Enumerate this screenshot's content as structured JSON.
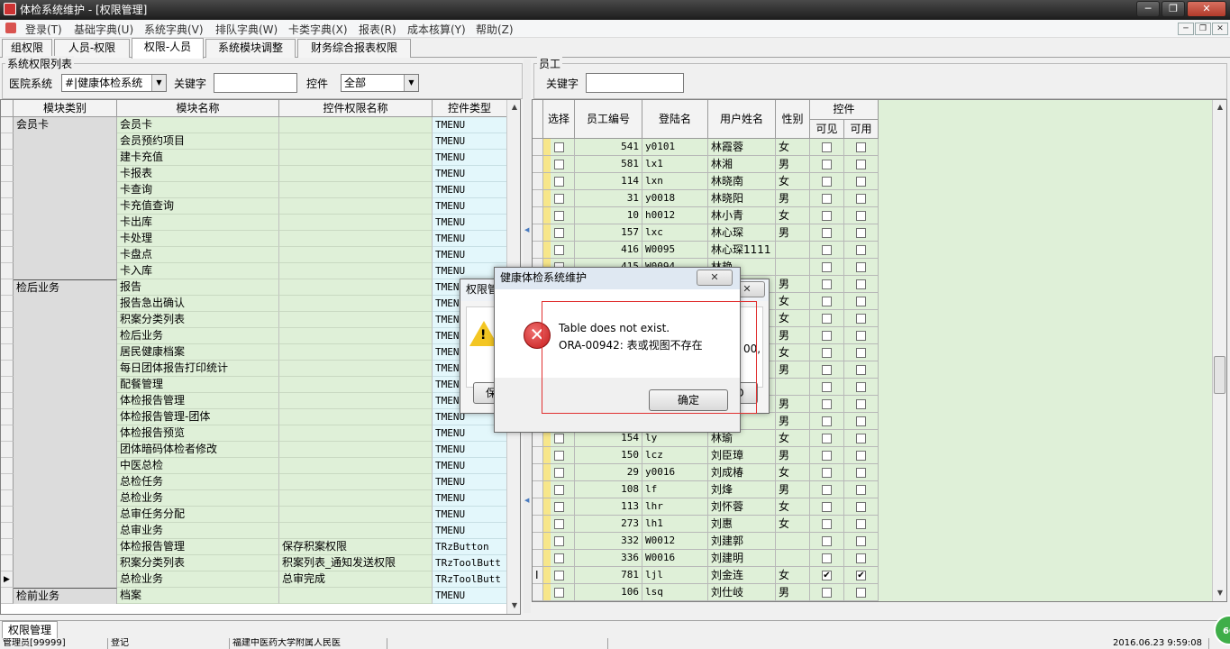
{
  "window": {
    "title": "体检系统维护 - [权限管理]"
  },
  "menu": [
    "登录(T)",
    "基础字典(U)",
    "系统字典(V)",
    "排队字典(W)",
    "卡类字典(X)",
    "报表(R)",
    "成本核算(Y)",
    "帮助(Z)"
  ],
  "tabs": [
    "组权限",
    "人员-权限",
    "权限-人员",
    "系统模块调整",
    "财务综合报表权限"
  ],
  "left": {
    "title": "系统权限列表",
    "hospital_label": "医院系统",
    "hospital_value": "#|健康体检系统",
    "keyword_label": "关键字",
    "keyword_value": "",
    "control_label": "控件",
    "control_value": "全部",
    "columns": [
      "模块类别",
      "模块名称",
      "控件权限名称",
      "控件类型"
    ],
    "rows": [
      {
        "cat": "会员卡",
        "name": "会员卡",
        "perm": "",
        "type": "TMENU"
      },
      {
        "cat": "",
        "name": "会员预约项目",
        "perm": "",
        "type": "TMENU"
      },
      {
        "cat": "",
        "name": "建卡充值",
        "perm": "",
        "type": "TMENU"
      },
      {
        "cat": "",
        "name": "卡报表",
        "perm": "",
        "type": "TMENU"
      },
      {
        "cat": "",
        "name": "卡查询",
        "perm": "",
        "type": "TMENU"
      },
      {
        "cat": "",
        "name": "卡充值查询",
        "perm": "",
        "type": "TMENU"
      },
      {
        "cat": "",
        "name": "卡出库",
        "perm": "",
        "type": "TMENU"
      },
      {
        "cat": "",
        "name": "卡处理",
        "perm": "",
        "type": "TMENU"
      },
      {
        "cat": "",
        "name": "卡盘点",
        "perm": "",
        "type": "TMENU"
      },
      {
        "cat": "",
        "name": "卡入库",
        "perm": "",
        "type": "TMENU"
      },
      {
        "cat": "检后业务",
        "name": "报告",
        "perm": "",
        "type": "TMENU"
      },
      {
        "cat": "",
        "name": "报告急出确认",
        "perm": "",
        "type": "TMENU"
      },
      {
        "cat": "",
        "name": "积案分类列表",
        "perm": "",
        "type": "TMENU"
      },
      {
        "cat": "",
        "name": "检后业务",
        "perm": "",
        "type": "TMENU"
      },
      {
        "cat": "",
        "name": "居民健康档案",
        "perm": "",
        "type": "TMENU"
      },
      {
        "cat": "",
        "name": "每日团体报告打印统计",
        "perm": "",
        "type": "TMENU"
      },
      {
        "cat": "",
        "name": "配餐管理",
        "perm": "",
        "type": "TMENU"
      },
      {
        "cat": "",
        "name": "体检报告管理",
        "perm": "",
        "type": "TMENU"
      },
      {
        "cat": "",
        "name": "体检报告管理-团体",
        "perm": "",
        "type": "TMENU"
      },
      {
        "cat": "",
        "name": "体检报告预览",
        "perm": "",
        "type": "TMENU"
      },
      {
        "cat": "",
        "name": "团体暗码体检者修改",
        "perm": "",
        "type": "TMENU"
      },
      {
        "cat": "",
        "name": "中医总检",
        "perm": "",
        "type": "TMENU"
      },
      {
        "cat": "",
        "name": "总检任务",
        "perm": "",
        "type": "TMENU"
      },
      {
        "cat": "",
        "name": "总检业务",
        "perm": "",
        "type": "TMENU"
      },
      {
        "cat": "",
        "name": "总审任务分配",
        "perm": "",
        "type": "TMENU"
      },
      {
        "cat": "",
        "name": "总审业务",
        "perm": "",
        "type": "TMENU"
      },
      {
        "cat": "",
        "name": "体检报告管理",
        "perm": "保存积案权限",
        "type": "TRzButton"
      },
      {
        "cat": "",
        "name": "积案分类列表",
        "perm": "积案列表_通知发送权限",
        "type": "TRzToolButt"
      },
      {
        "cat": "",
        "name": "总检业务",
        "perm": "总审完成",
        "type": "TRzToolButt"
      },
      {
        "cat": "检前业务",
        "name": "档案",
        "perm": "",
        "type": "TMENU"
      }
    ]
  },
  "right": {
    "title": "员工",
    "keyword_label": "关键字",
    "keyword_value": "",
    "columns": {
      "select": "选择",
      "id": "员工编号",
      "login": "登陆名",
      "name": "用户姓名",
      "sex": "性别",
      "control": "控件",
      "visible": "可见",
      "enabled": "可用"
    },
    "rows": [
      {
        "id": "541",
        "login": "y0101",
        "name": "林霞蓉",
        "sex": "女",
        "vis": false,
        "en": false
      },
      {
        "id": "581",
        "login": "lx1",
        "name": "林湘",
        "sex": "男",
        "vis": false,
        "en": false
      },
      {
        "id": "114",
        "login": "lxn",
        "name": "林晓南",
        "sex": "女",
        "vis": false,
        "en": false
      },
      {
        "id": "31",
        "login": "y0018",
        "name": "林晓阳",
        "sex": "男",
        "vis": false,
        "en": false
      },
      {
        "id": "10",
        "login": "h0012",
        "name": "林小青",
        "sex": "女",
        "vis": false,
        "en": false
      },
      {
        "id": "157",
        "login": "lxc",
        "name": "林心琛",
        "sex": "男",
        "vis": false,
        "en": false
      },
      {
        "id": "416",
        "login": "W0095",
        "name": "林心琛1111",
        "sex": "",
        "vis": false,
        "en": false
      },
      {
        "id": "415",
        "login": "W0094",
        "name": "林艳",
        "sex": "",
        "vis": false,
        "en": false
      },
      {
        "id": "",
        "login": "",
        "name": "",
        "sex": "男",
        "vis": false,
        "en": false
      },
      {
        "id": "",
        "login": "",
        "name": "",
        "sex": "女",
        "vis": false,
        "en": false
      },
      {
        "id": "",
        "login": "",
        "name": "",
        "sex": "女",
        "vis": false,
        "en": false
      },
      {
        "id": "",
        "login": "",
        "name": "",
        "sex": "男",
        "vis": false,
        "en": false
      },
      {
        "id": "",
        "login": "",
        "name": "",
        "sex": "女",
        "vis": false,
        "en": false
      },
      {
        "id": "",
        "login": "",
        "name": "",
        "sex": "男",
        "vis": false,
        "en": false
      },
      {
        "id": "",
        "login": "",
        "name": "",
        "sex": "",
        "vis": false,
        "en": false
      },
      {
        "id": "",
        "login": "",
        "name": "",
        "sex": "男",
        "vis": false,
        "en": false
      },
      {
        "id": "",
        "login": "",
        "name": "",
        "sex": "男",
        "vis": false,
        "en": false
      },
      {
        "id": "154",
        "login": "ly",
        "name": "林瑜",
        "sex": "女",
        "vis": false,
        "en": false
      },
      {
        "id": "150",
        "login": "lcz",
        "name": "刘臣璋",
        "sex": "男",
        "vis": false,
        "en": false
      },
      {
        "id": "29",
        "login": "y0016",
        "name": "刘成椿",
        "sex": "女",
        "vis": false,
        "en": false
      },
      {
        "id": "108",
        "login": "lf",
        "name": "刘烽",
        "sex": "男",
        "vis": false,
        "en": false
      },
      {
        "id": "113",
        "login": "lhr",
        "name": "刘怀蓉",
        "sex": "女",
        "vis": false,
        "en": false
      },
      {
        "id": "273",
        "login": "lh1",
        "name": "刘惠",
        "sex": "女",
        "vis": false,
        "en": false
      },
      {
        "id": "332",
        "login": "W0012",
        "name": "刘建郭",
        "sex": "",
        "vis": false,
        "en": false
      },
      {
        "id": "336",
        "login": "W0016",
        "name": "刘建明",
        "sex": "",
        "vis": false,
        "en": false
      },
      {
        "id": "781",
        "login": "ljl",
        "name": "刘金连",
        "sex": "女",
        "vis": true,
        "en": true
      },
      {
        "id": "106",
        "login": "lsq",
        "name": "刘仕岐",
        "sex": "男",
        "vis": false,
        "en": false
      }
    ]
  },
  "back_dialog": {
    "title": "权限管",
    "button_left": "保",
    "button_right": "D",
    "text_fragment": "00,"
  },
  "error_dialog": {
    "title": "健康体检系统维护",
    "line1": "Table does not exist.",
    "line2": "ORA-00942: 表或视图不存在",
    "ok": "确定"
  },
  "status": {
    "tab": "权限管理",
    "user": "管理员[99999]",
    "state": "登记",
    "hospital": "福建中医药大学附属人民医",
    "datetime": "2016.06.23 9:59:08",
    "badge": "60"
  },
  "icons": [
    "app-icon",
    "warning-icon",
    "error-icon",
    "close-icon",
    "minimize-icon",
    "maximize-icon",
    "dropdown-arrow-icon"
  ]
}
